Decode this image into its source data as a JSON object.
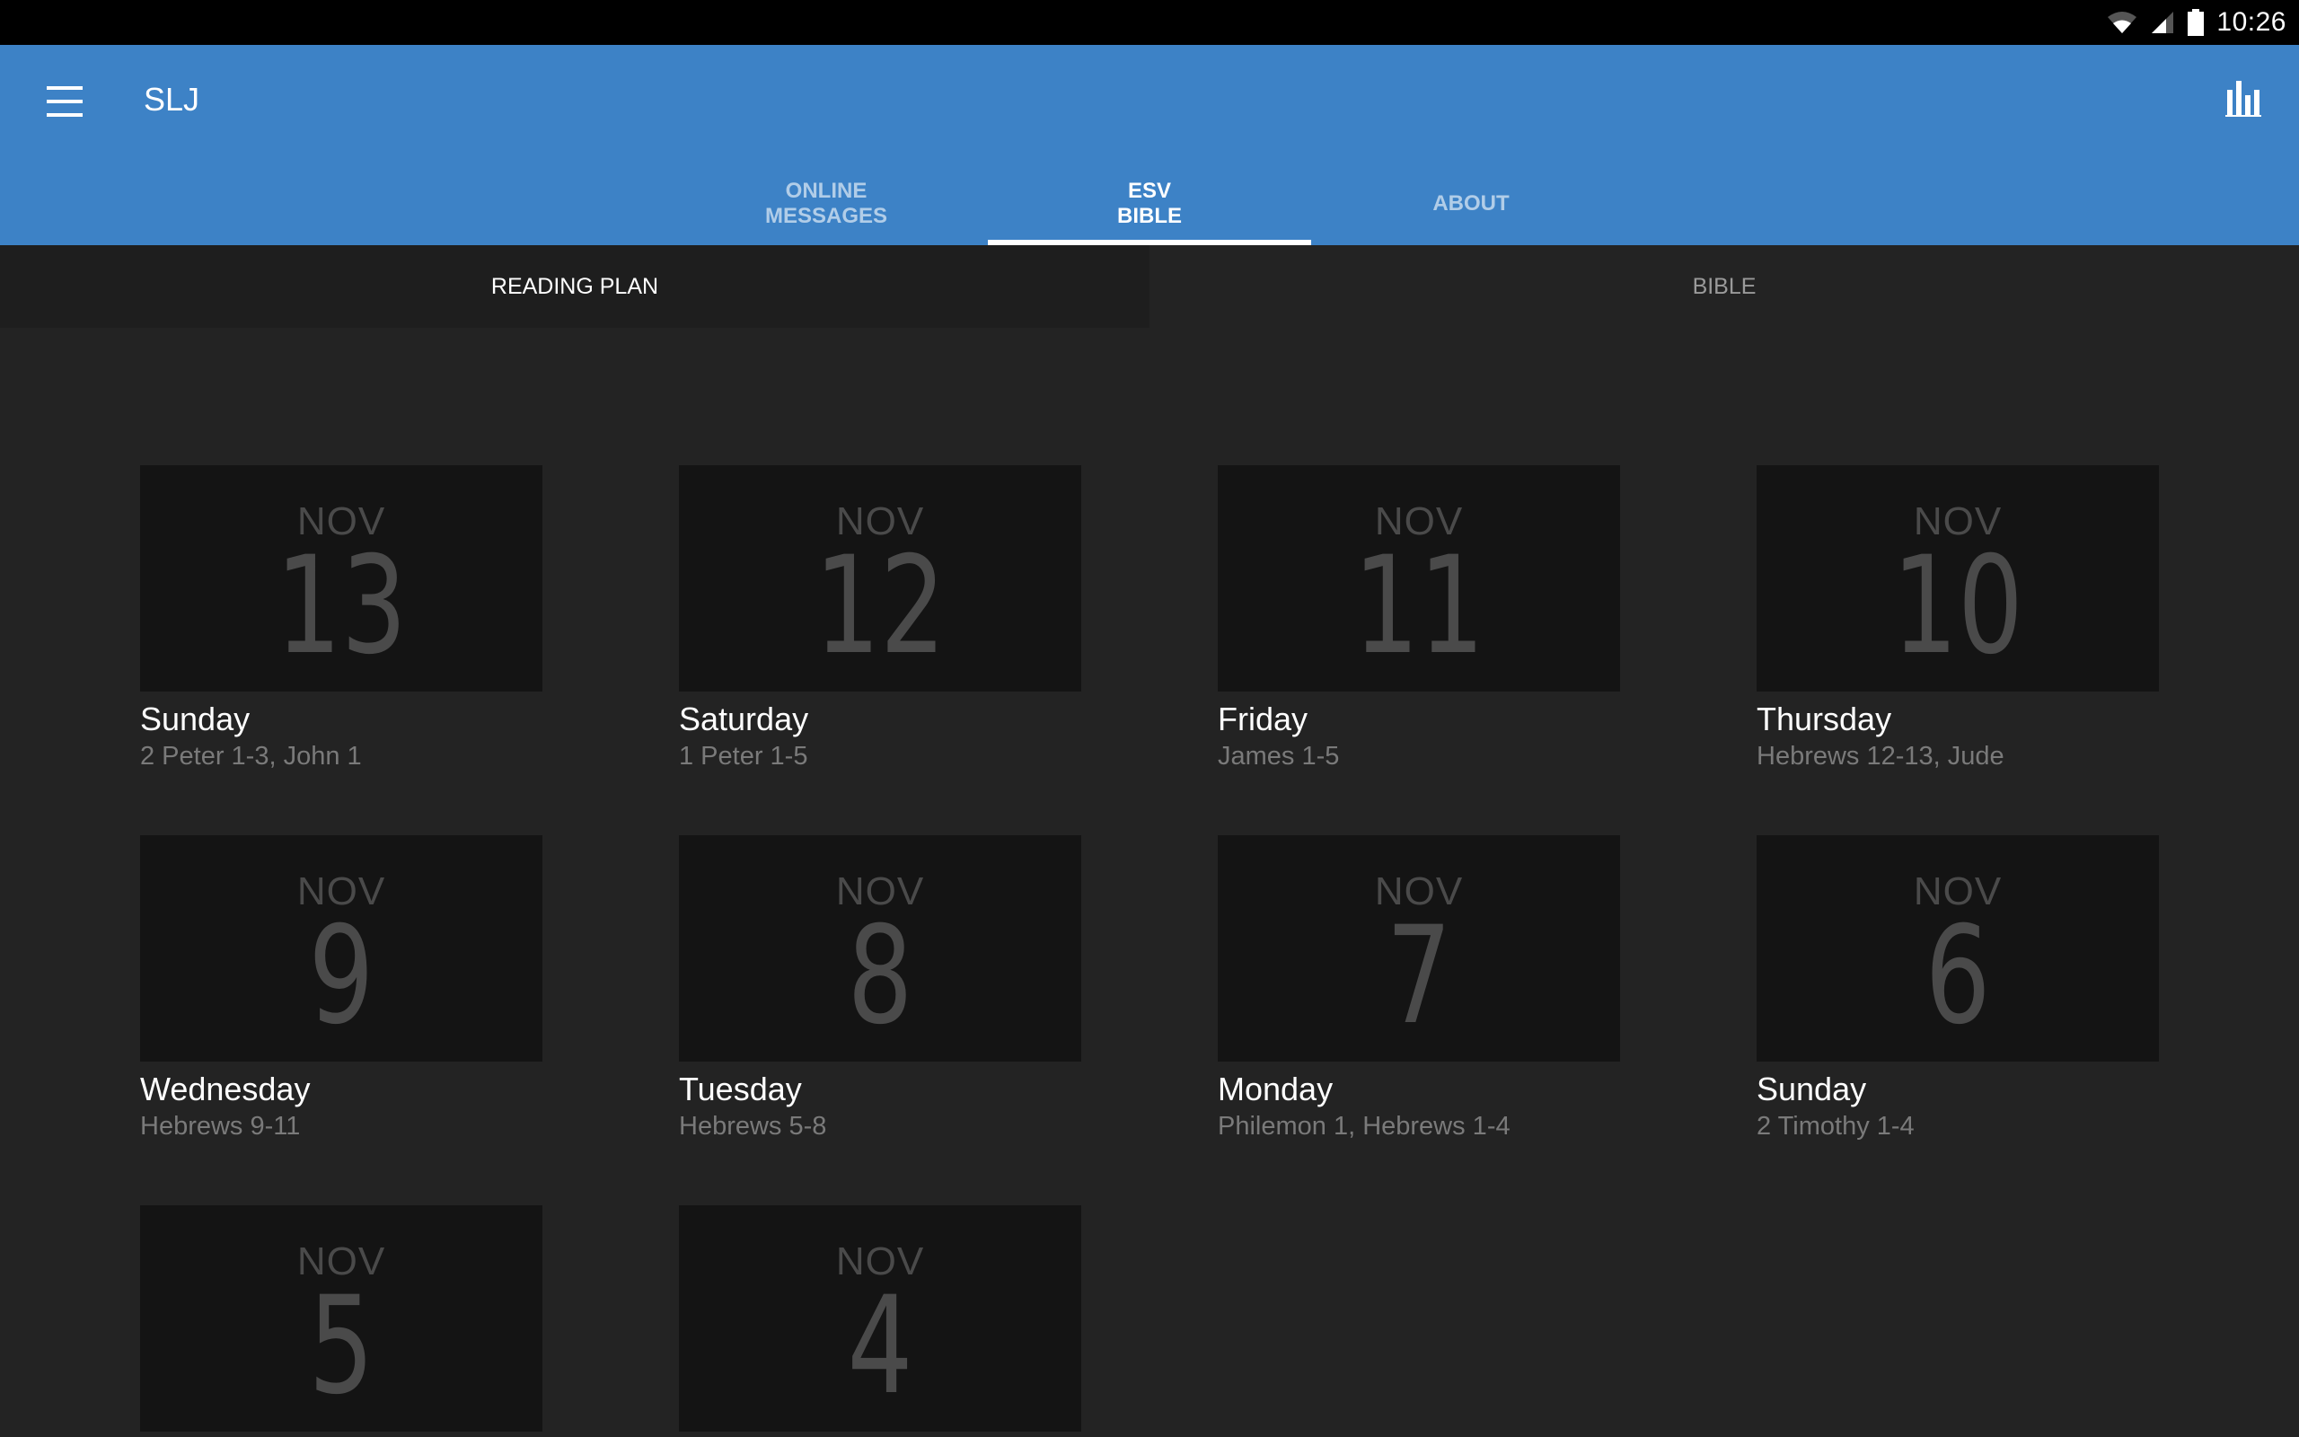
{
  "status_bar": {
    "time": "10:26",
    "icons": [
      "wifi-icon",
      "cell-signal-icon",
      "battery-icon"
    ]
  },
  "app_bar": {
    "title": "SLJ",
    "menu_icon": "hamburger-menu-icon",
    "action_icon": "bar-chart-icon",
    "accent_color": "#3d82c6"
  },
  "tabs": [
    {
      "label": "ONLINE\nMESSAGES",
      "active": false
    },
    {
      "label": "ESV\nBIBLE",
      "active": true
    },
    {
      "label": "ABOUT",
      "active": false
    }
  ],
  "subtabs": [
    {
      "label": "READING PLAN",
      "active": true
    },
    {
      "label": "BIBLE",
      "active": false
    }
  ],
  "reading_plan": [
    {
      "month": "NOV",
      "day": "13",
      "weekday": "Sunday",
      "reading": "2 Peter 1-3, John 1"
    },
    {
      "month": "NOV",
      "day": "12",
      "weekday": "Saturday",
      "reading": "1 Peter 1-5"
    },
    {
      "month": "NOV",
      "day": "11",
      "weekday": "Friday",
      "reading": "James 1-5"
    },
    {
      "month": "NOV",
      "day": "10",
      "weekday": "Thursday",
      "reading": "Hebrews 12-13, Jude"
    },
    {
      "month": "NOV",
      "day": "9",
      "weekday": "Wednesday",
      "reading": "Hebrews 9-11"
    },
    {
      "month": "NOV",
      "day": "8",
      "weekday": "Tuesday",
      "reading": "Hebrews 5-8"
    },
    {
      "month": "NOV",
      "day": "7",
      "weekday": "Monday",
      "reading": "Philemon 1, Hebrews 1-4"
    },
    {
      "month": "NOV",
      "day": "6",
      "weekday": "Sunday",
      "reading": "2 Timothy 1-4"
    },
    {
      "month": "NOV",
      "day": "5",
      "weekday": "",
      "reading": ""
    },
    {
      "month": "NOV",
      "day": "4",
      "weekday": "",
      "reading": ""
    }
  ]
}
